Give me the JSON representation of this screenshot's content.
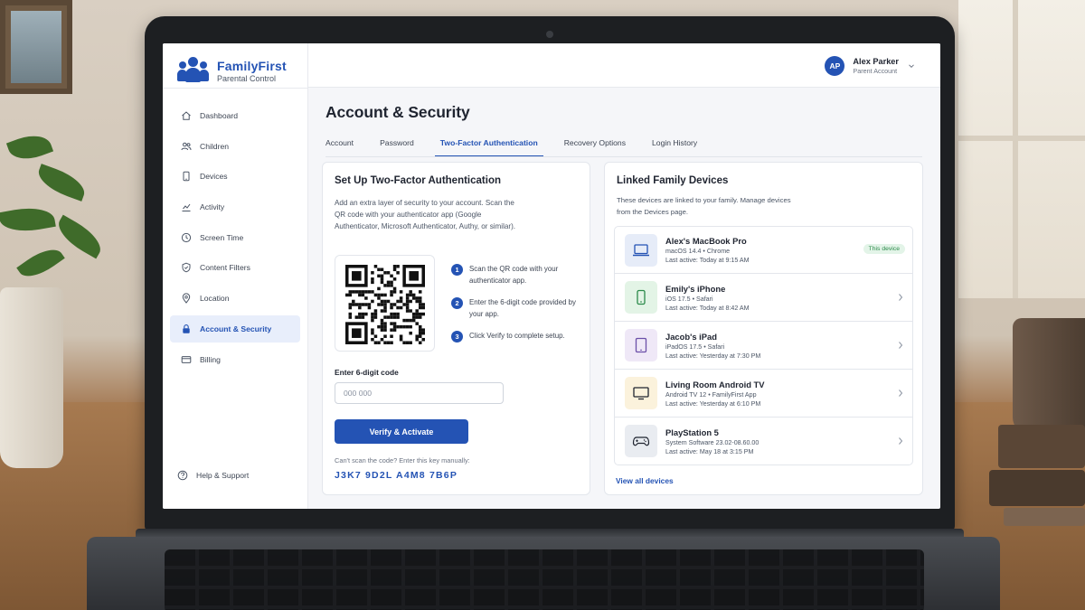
{
  "brand": {
    "name": "FamilyFirst",
    "subtitle": "Parental Control"
  },
  "user": {
    "initials": "AP",
    "name": "Alex Parker",
    "role": "Parent Account"
  },
  "sidebar": {
    "items": [
      {
        "label": "Dashboard",
        "icon": "home-icon"
      },
      {
        "label": "Children",
        "icon": "users-icon"
      },
      {
        "label": "Devices",
        "icon": "phone-icon"
      },
      {
        "label": "Activity",
        "icon": "activity-chart-icon"
      },
      {
        "label": "Screen Time",
        "icon": "clock-icon"
      },
      {
        "label": "Content Filters",
        "icon": "shield-icon"
      },
      {
        "label": "Location",
        "icon": "location-pin-icon"
      },
      {
        "label": "Account & Security",
        "icon": "lock-icon",
        "active": true
      },
      {
        "label": "Billing",
        "icon": "credit-card-icon"
      }
    ],
    "help": "Help & Support"
  },
  "page": {
    "title": "Account & Security",
    "tabs": [
      {
        "label": "Account"
      },
      {
        "label": "Password"
      },
      {
        "label": "Two-Factor Authentication",
        "active": true
      },
      {
        "label": "Recovery Options"
      },
      {
        "label": "Login History"
      }
    ]
  },
  "twofa": {
    "title": "Set Up Two-Factor Authentication",
    "description": "Add an extra layer of security to your account. Scan the QR code with your authenticator app (Google Authenticator, Microsoft Authenticator, Authy, or similar).",
    "steps": [
      {
        "num": "1",
        "text": "Scan the QR code with your authenticator app."
      },
      {
        "num": "2",
        "text": "Enter the 6-digit code provided by your app."
      },
      {
        "num": "3",
        "text": "Click Verify to complete setup."
      }
    ],
    "code_label": "Enter 6-digit code",
    "code_placeholder": "000 000",
    "verify_label": "Verify & Activate",
    "manual_hint": "Can't scan the code? Enter this key manually:",
    "manual_key": "J3K7 9D2L A4M8 7B6P"
  },
  "devices": {
    "title": "Linked Family Devices",
    "description": "These devices are linked to your family. Manage devices from the Devices page.",
    "items": [
      {
        "name": "Alex's MacBook Pro",
        "os": "macOS 14.4 • Chrome",
        "last_active": "Last active: Today at 9:15 AM",
        "badge": "This device",
        "icon": "laptop-icon",
        "color": "#e6ecf8"
      },
      {
        "name": "Emily's iPhone",
        "os": "iOS 17.5 • Safari",
        "last_active": "Last active: Today at 8:42 AM",
        "icon": "smartphone-icon",
        "color": "#e3f4e6"
      },
      {
        "name": "Jacob's iPad",
        "os": "iPadOS 17.5 • Safari",
        "last_active": "Last active: Yesterday at 7:30 PM",
        "icon": "tablet-icon",
        "color": "#efe8f7"
      },
      {
        "name": "Living Room Android TV",
        "os": "Android TV 12 • FamilyFirst App",
        "last_active": "Last active: Yesterday at 6:10 PM",
        "icon": "tv-icon",
        "color": "#fbf2dc"
      },
      {
        "name": "PlayStation 5",
        "os": "System Software 23.02-08.60.00",
        "last_active": "Last active: May 18 at 3:15 PM",
        "icon": "gamepad-icon",
        "color": "#e9ecf1"
      }
    ],
    "view_all": "View all devices"
  },
  "colors": {
    "accent": "#2453b4",
    "background": "#f5f6f9",
    "success": "#2b8a4a"
  }
}
